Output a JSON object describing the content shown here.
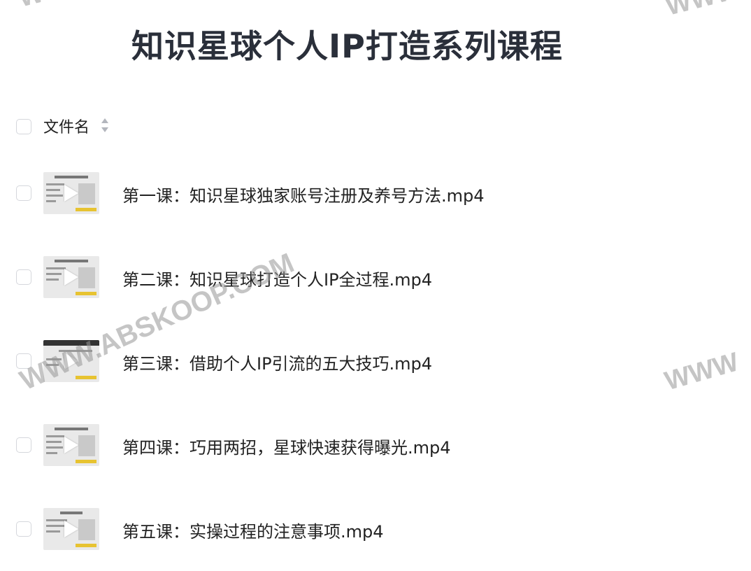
{
  "page": {
    "title": "知识星球个人IP打造系列课程"
  },
  "table": {
    "header_label": "文件名",
    "files": [
      {
        "name": "第一课：知识星球独家账号注册及养号方法.mp4"
      },
      {
        "name": "第二课：知识星球打造个人IP全过程.mp4"
      },
      {
        "name": "第三课：借助个人IP引流的五大技巧.mp4"
      },
      {
        "name": "第四课：巧用两招，星球快速获得曝光.mp4"
      },
      {
        "name": "第五课：实操过程的注意事项.mp4"
      }
    ]
  },
  "watermarks": {
    "center": "WWW.ABSKOOP.COM",
    "top_left": "WWW",
    "top_right": "WWW",
    "right": "WWW"
  },
  "icons": {
    "sort": "sort-icon",
    "play": "play-icon",
    "checkbox": "checkbox"
  },
  "colors": {
    "title": "#2a2f3a",
    "checkbox_border": "#d5d7dc",
    "watermark": "#969696",
    "thumb_accent": "#e7c331"
  }
}
